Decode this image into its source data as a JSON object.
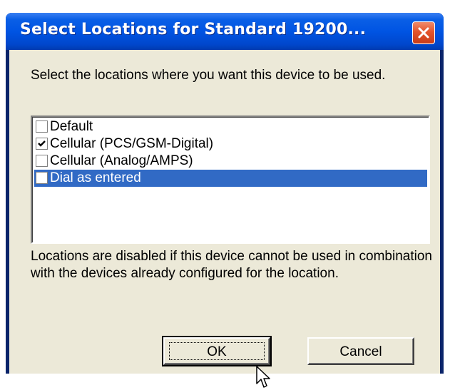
{
  "window": {
    "title": "Select Locations for Standard 19200..."
  },
  "dialog": {
    "prompt": "Select the locations where you want this device to be used.",
    "locations": [
      {
        "label": "Default",
        "checked": false,
        "selected": false
      },
      {
        "label": "Cellular (PCS/GSM-Digital)",
        "checked": true,
        "selected": false
      },
      {
        "label": "Cellular (Analog/AMPS)",
        "checked": false,
        "selected": false
      },
      {
        "label": "Dial as entered",
        "checked": false,
        "selected": true
      }
    ],
    "note": "Locations are disabled if this device cannot be used in combination with the devices already configured for the location."
  },
  "buttons": {
    "ok_label": "OK",
    "cancel_label": "Cancel"
  },
  "colors": {
    "titlebar": "#0054e3",
    "selection": "#316ac5",
    "dialog_bg": "#ece9d8",
    "close_button": "#e4542c"
  },
  "icons": {
    "close": "close-x-icon",
    "check": "checkmark-icon",
    "cursor": "arrow-cursor-icon"
  }
}
